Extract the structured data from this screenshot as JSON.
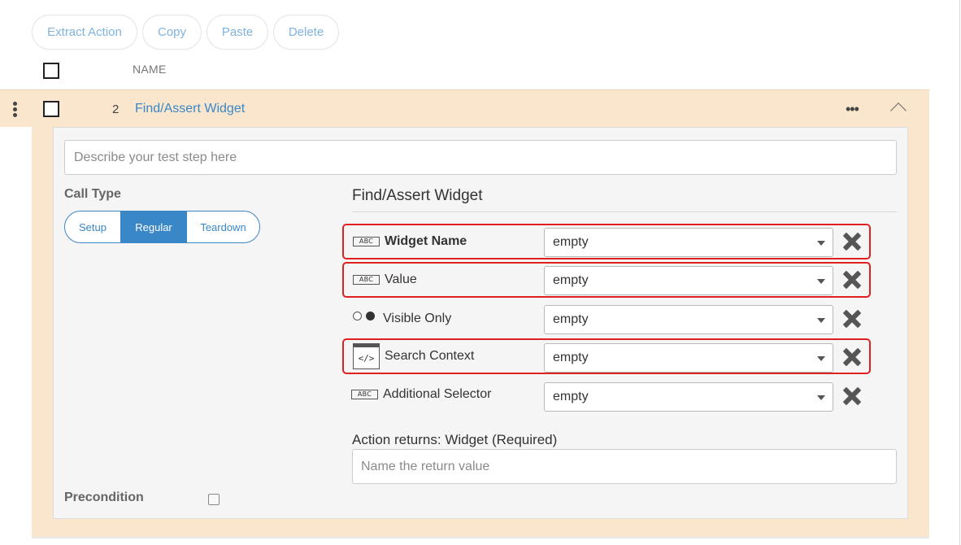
{
  "toolbar": {
    "extract_action": "Extract Action",
    "copy": "Copy",
    "paste": "Paste",
    "delete": "Delete"
  },
  "table": {
    "column_name": "NAME"
  },
  "step": {
    "number": "2",
    "title": "Find/Assert Widget",
    "more_icon": "more-horizontal-icon",
    "collapse_icon": "chevron-up-icon",
    "description_placeholder": "Describe your test step here",
    "call_type_label": "Call Type",
    "call_types": [
      "Setup",
      "Regular",
      "Teardown"
    ],
    "selected_call_type": "Regular",
    "section_title": "Find/Assert Widget",
    "params": [
      {
        "label": "Widget Name",
        "type_icon": "abc-string-icon",
        "type_text": "ABC",
        "value": "empty",
        "bold": true,
        "highlighted": true
      },
      {
        "label": "Value",
        "type_icon": "abc-string-icon",
        "type_text": "ABC",
        "value": "empty",
        "bold": false,
        "highlighted": true
      },
      {
        "label": "Visible Only",
        "type_icon": "boolean-radio-icon",
        "value": "empty",
        "bold": false,
        "highlighted": false
      },
      {
        "label": "Search Context",
        "type_icon": "code-window-icon",
        "type_text": "</>",
        "value": "empty",
        "bold": false,
        "highlighted": true
      },
      {
        "label": "Additional Selector",
        "type_icon": "abc-string-icon",
        "type_text": "ABC",
        "value": "empty",
        "bold": false,
        "highlighted": false
      }
    ],
    "returns_label": "Action returns: Widget (Required)",
    "return_placeholder": "Name the return value",
    "precondition_label": "Precondition"
  },
  "colors": {
    "accent": "#3a87c8",
    "row_background": "#f9e6cc",
    "highlight": "#e02020"
  }
}
